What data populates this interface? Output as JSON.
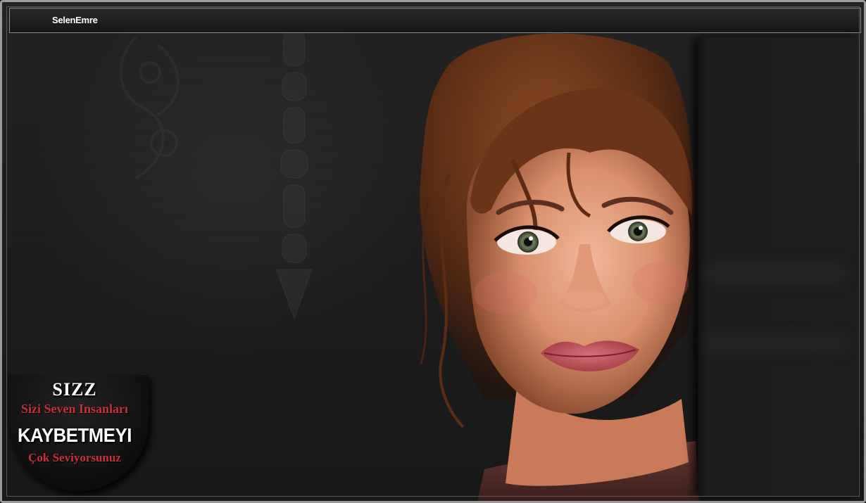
{
  "window": {
    "title": "SelenEmre"
  },
  "badge": {
    "line1": "SIZZ",
    "line2": "Sizi Seven Insanları",
    "line3": "KAYBETMEYI",
    "line4": "Çok Seviyorsunuz",
    "accent_color": "#c5323a"
  },
  "image": {
    "subject_icon": "portrait-icon"
  }
}
